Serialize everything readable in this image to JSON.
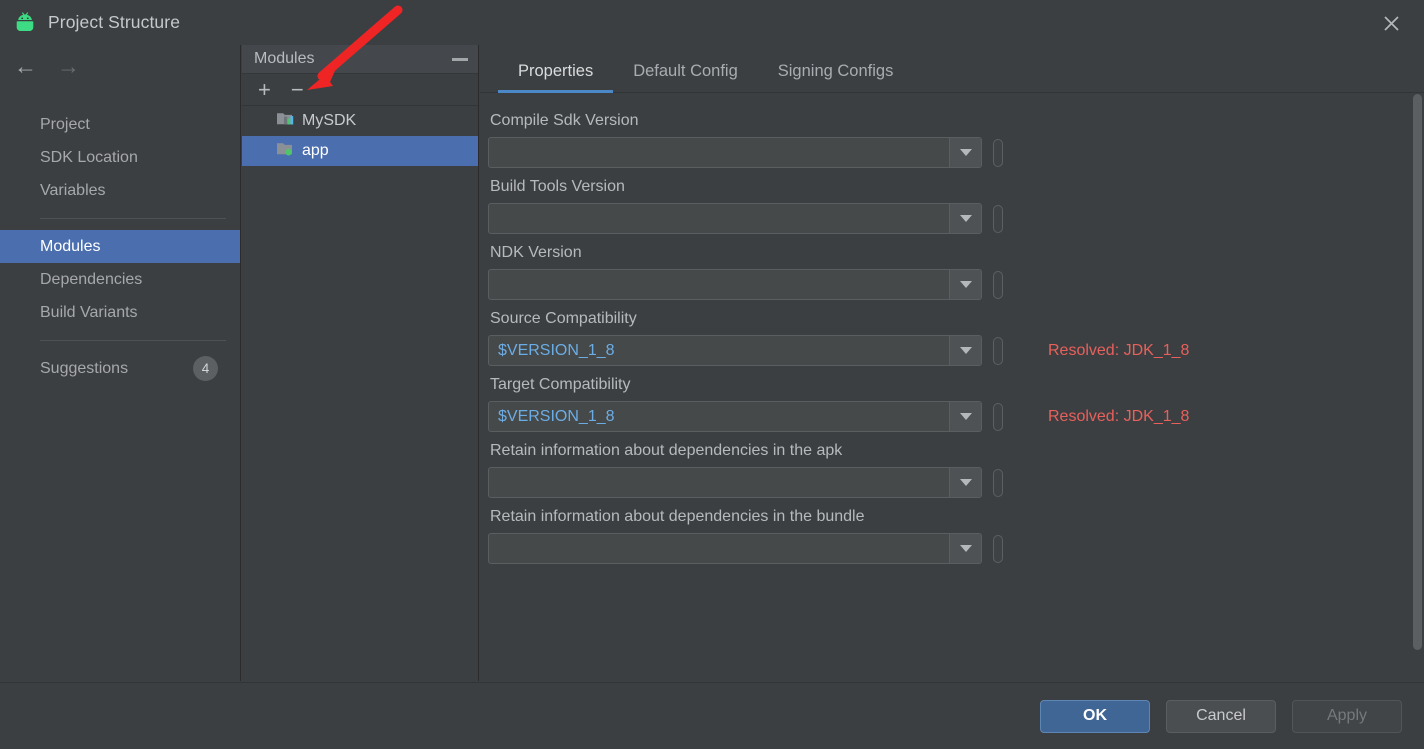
{
  "window": {
    "title": "Project Structure",
    "app_icon": "android-robot-icon",
    "close_icon": "close-icon"
  },
  "nav": {
    "back_icon": "arrow-left-icon",
    "forward_icon": "arrow-right-icon",
    "back_label": "←",
    "forward_label": "→"
  },
  "sidebar": {
    "items": [
      {
        "label": "Project",
        "selected": false,
        "badge": ""
      },
      {
        "label": "SDK Location",
        "selected": false,
        "badge": ""
      },
      {
        "label": "Variables",
        "selected": false,
        "badge": ""
      },
      {
        "label": "Modules",
        "selected": true,
        "badge": ""
      },
      {
        "label": "Dependencies",
        "selected": false,
        "badge": ""
      },
      {
        "label": "Build Variants",
        "selected": false,
        "badge": ""
      },
      {
        "label": "Suggestions",
        "selected": false,
        "badge": "4"
      }
    ]
  },
  "modules_panel": {
    "header_title": "Modules",
    "minimize_icon": "minimize-icon",
    "add_label": "+",
    "remove_label": "−",
    "items": [
      {
        "label": "MySDK",
        "icon": "library-folder-icon",
        "selected": false,
        "squiggle": "#d9a21b"
      },
      {
        "label": "app",
        "icon": "app-folder-icon",
        "selected": true,
        "squiggle": "#2f4f8a"
      }
    ]
  },
  "tabs": [
    {
      "label": "Properties",
      "active": true
    },
    {
      "label": "Default Config",
      "active": false
    },
    {
      "label": "Signing Configs",
      "active": false
    }
  ],
  "form": {
    "fields": [
      {
        "label": "Compile Sdk Version",
        "value": "",
        "resolved": ""
      },
      {
        "label": "Build Tools Version",
        "value": "",
        "resolved": ""
      },
      {
        "label": "NDK Version",
        "value": "",
        "resolved": ""
      },
      {
        "label": "Source Compatibility",
        "value": "$VERSION_1_8",
        "resolved": "Resolved: JDK_1_8"
      },
      {
        "label": "Target Compatibility",
        "value": "$VERSION_1_8",
        "resolved": "Resolved: JDK_1_8"
      },
      {
        "label": "Retain information about dependencies in the apk",
        "value": "",
        "resolved": ""
      },
      {
        "label": "Retain information about dependencies in the bundle",
        "value": "",
        "resolved": ""
      }
    ],
    "dropdown_icon": "chevron-down-icon",
    "variable_button_icon": "variable-picker-icon"
  },
  "footer": {
    "ok_label": "OK",
    "cancel_label": "Cancel",
    "apply_label": "Apply"
  },
  "annotation": {
    "arrow_color": "#ef2525",
    "arrow_name": "red-pointer-arrow"
  },
  "colors": {
    "accent_blue": "#4b6eaf",
    "tab_underline": "#4a88c7",
    "value_text": "#6cace4",
    "resolved_text": "#e8605c",
    "window_bg": "#3c3f41",
    "badge_bg": "#5c6063"
  }
}
